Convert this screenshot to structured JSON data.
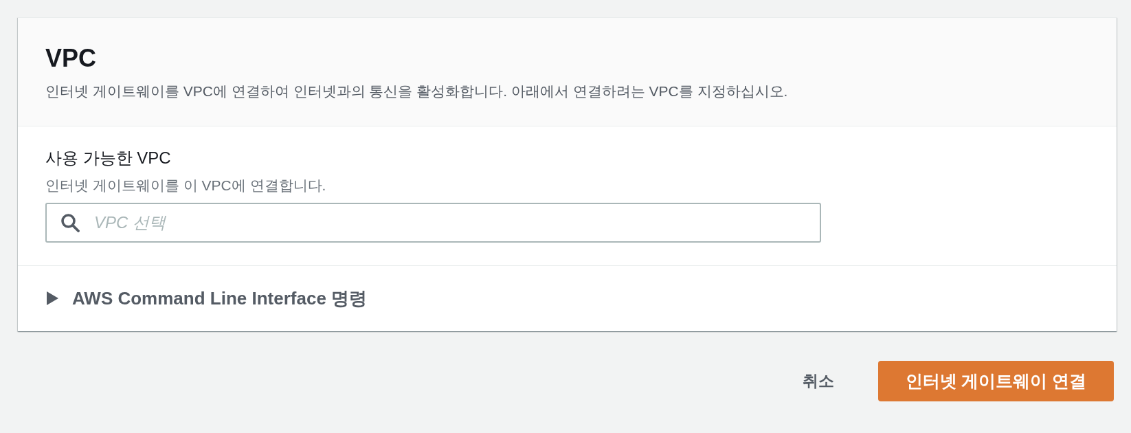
{
  "panel": {
    "title": "VPC",
    "description": "인터넷 게이트웨이를 VPC에 연결하여 인터넷과의 통신을 활성화합니다. 아래에서 연결하려는 VPC를 지정하십시오."
  },
  "field": {
    "label": "사용 가능한 VPC",
    "hint": "인터넷 게이트웨이를 이 VPC에 연결합니다.",
    "placeholder": "VPC 선택"
  },
  "expander": {
    "label": "AWS Command Line Interface 명령",
    "expanded": false
  },
  "actions": [
    {
      "kind": "link",
      "label": "취소"
    },
    {
      "kind": "primary",
      "label": "인터넷 게이트웨이 연결"
    }
  ]
}
